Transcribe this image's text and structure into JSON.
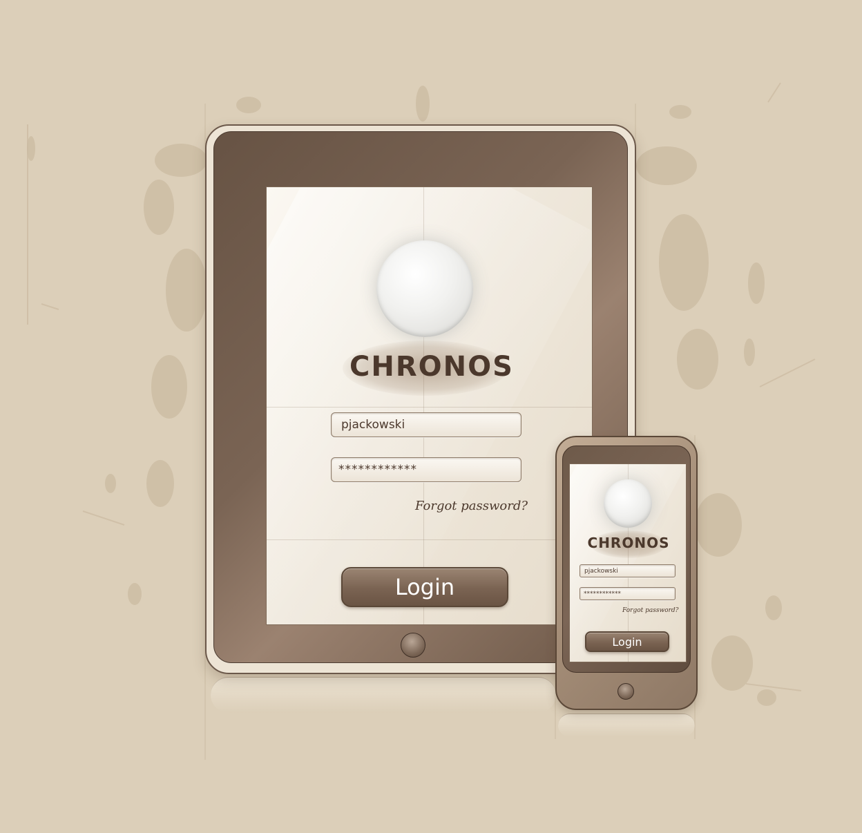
{
  "brand": {
    "name": "CHRONOS"
  },
  "tablet": {
    "username_value": "pjackowski",
    "password_value": "************",
    "forgot_link": "Forgot password?",
    "login_label": "Login"
  },
  "phone": {
    "username_value": "pjackowski",
    "password_value": "************",
    "forgot_link": "Forgot password?",
    "login_label": "Login"
  },
  "icons": {
    "avatar": "avatar-placeholder-icon",
    "home": "home-button-icon"
  },
  "colors": {
    "background": "#dccfb9",
    "bezel": "#6b5646",
    "text": "#4b382c",
    "button": "#7a6352"
  }
}
